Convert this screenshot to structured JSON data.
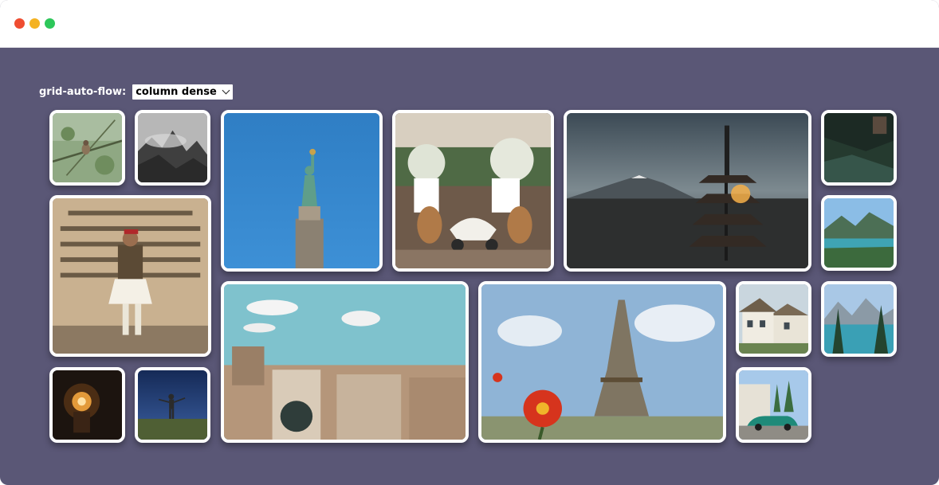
{
  "window": {
    "controls": [
      "close",
      "minimize",
      "zoom"
    ]
  },
  "control": {
    "label": "grid-auto-flow:",
    "select_value": "column dense"
  },
  "photos": [
    {
      "name": "bird-on-branch-photo"
    },
    {
      "name": "misty-mountains-photo"
    },
    {
      "name": "statue-of-liberty-photo"
    },
    {
      "name": "cafe-scooter-photo"
    },
    {
      "name": "pagoda-mount-fuji-photo"
    },
    {
      "name": "forest-cliff-photo"
    },
    {
      "name": "greek-guard-photo"
    },
    {
      "name": "mountain-lake-photo"
    },
    {
      "name": "city-rooftops-photo"
    },
    {
      "name": "eiffel-tower-flower-photo"
    },
    {
      "name": "thatched-cottages-photo"
    },
    {
      "name": "alpine-lake-pines-photo"
    },
    {
      "name": "glowing-lamp-photo"
    },
    {
      "name": "person-in-field-photo"
    },
    {
      "name": "vintage-car-street-photo"
    }
  ]
}
